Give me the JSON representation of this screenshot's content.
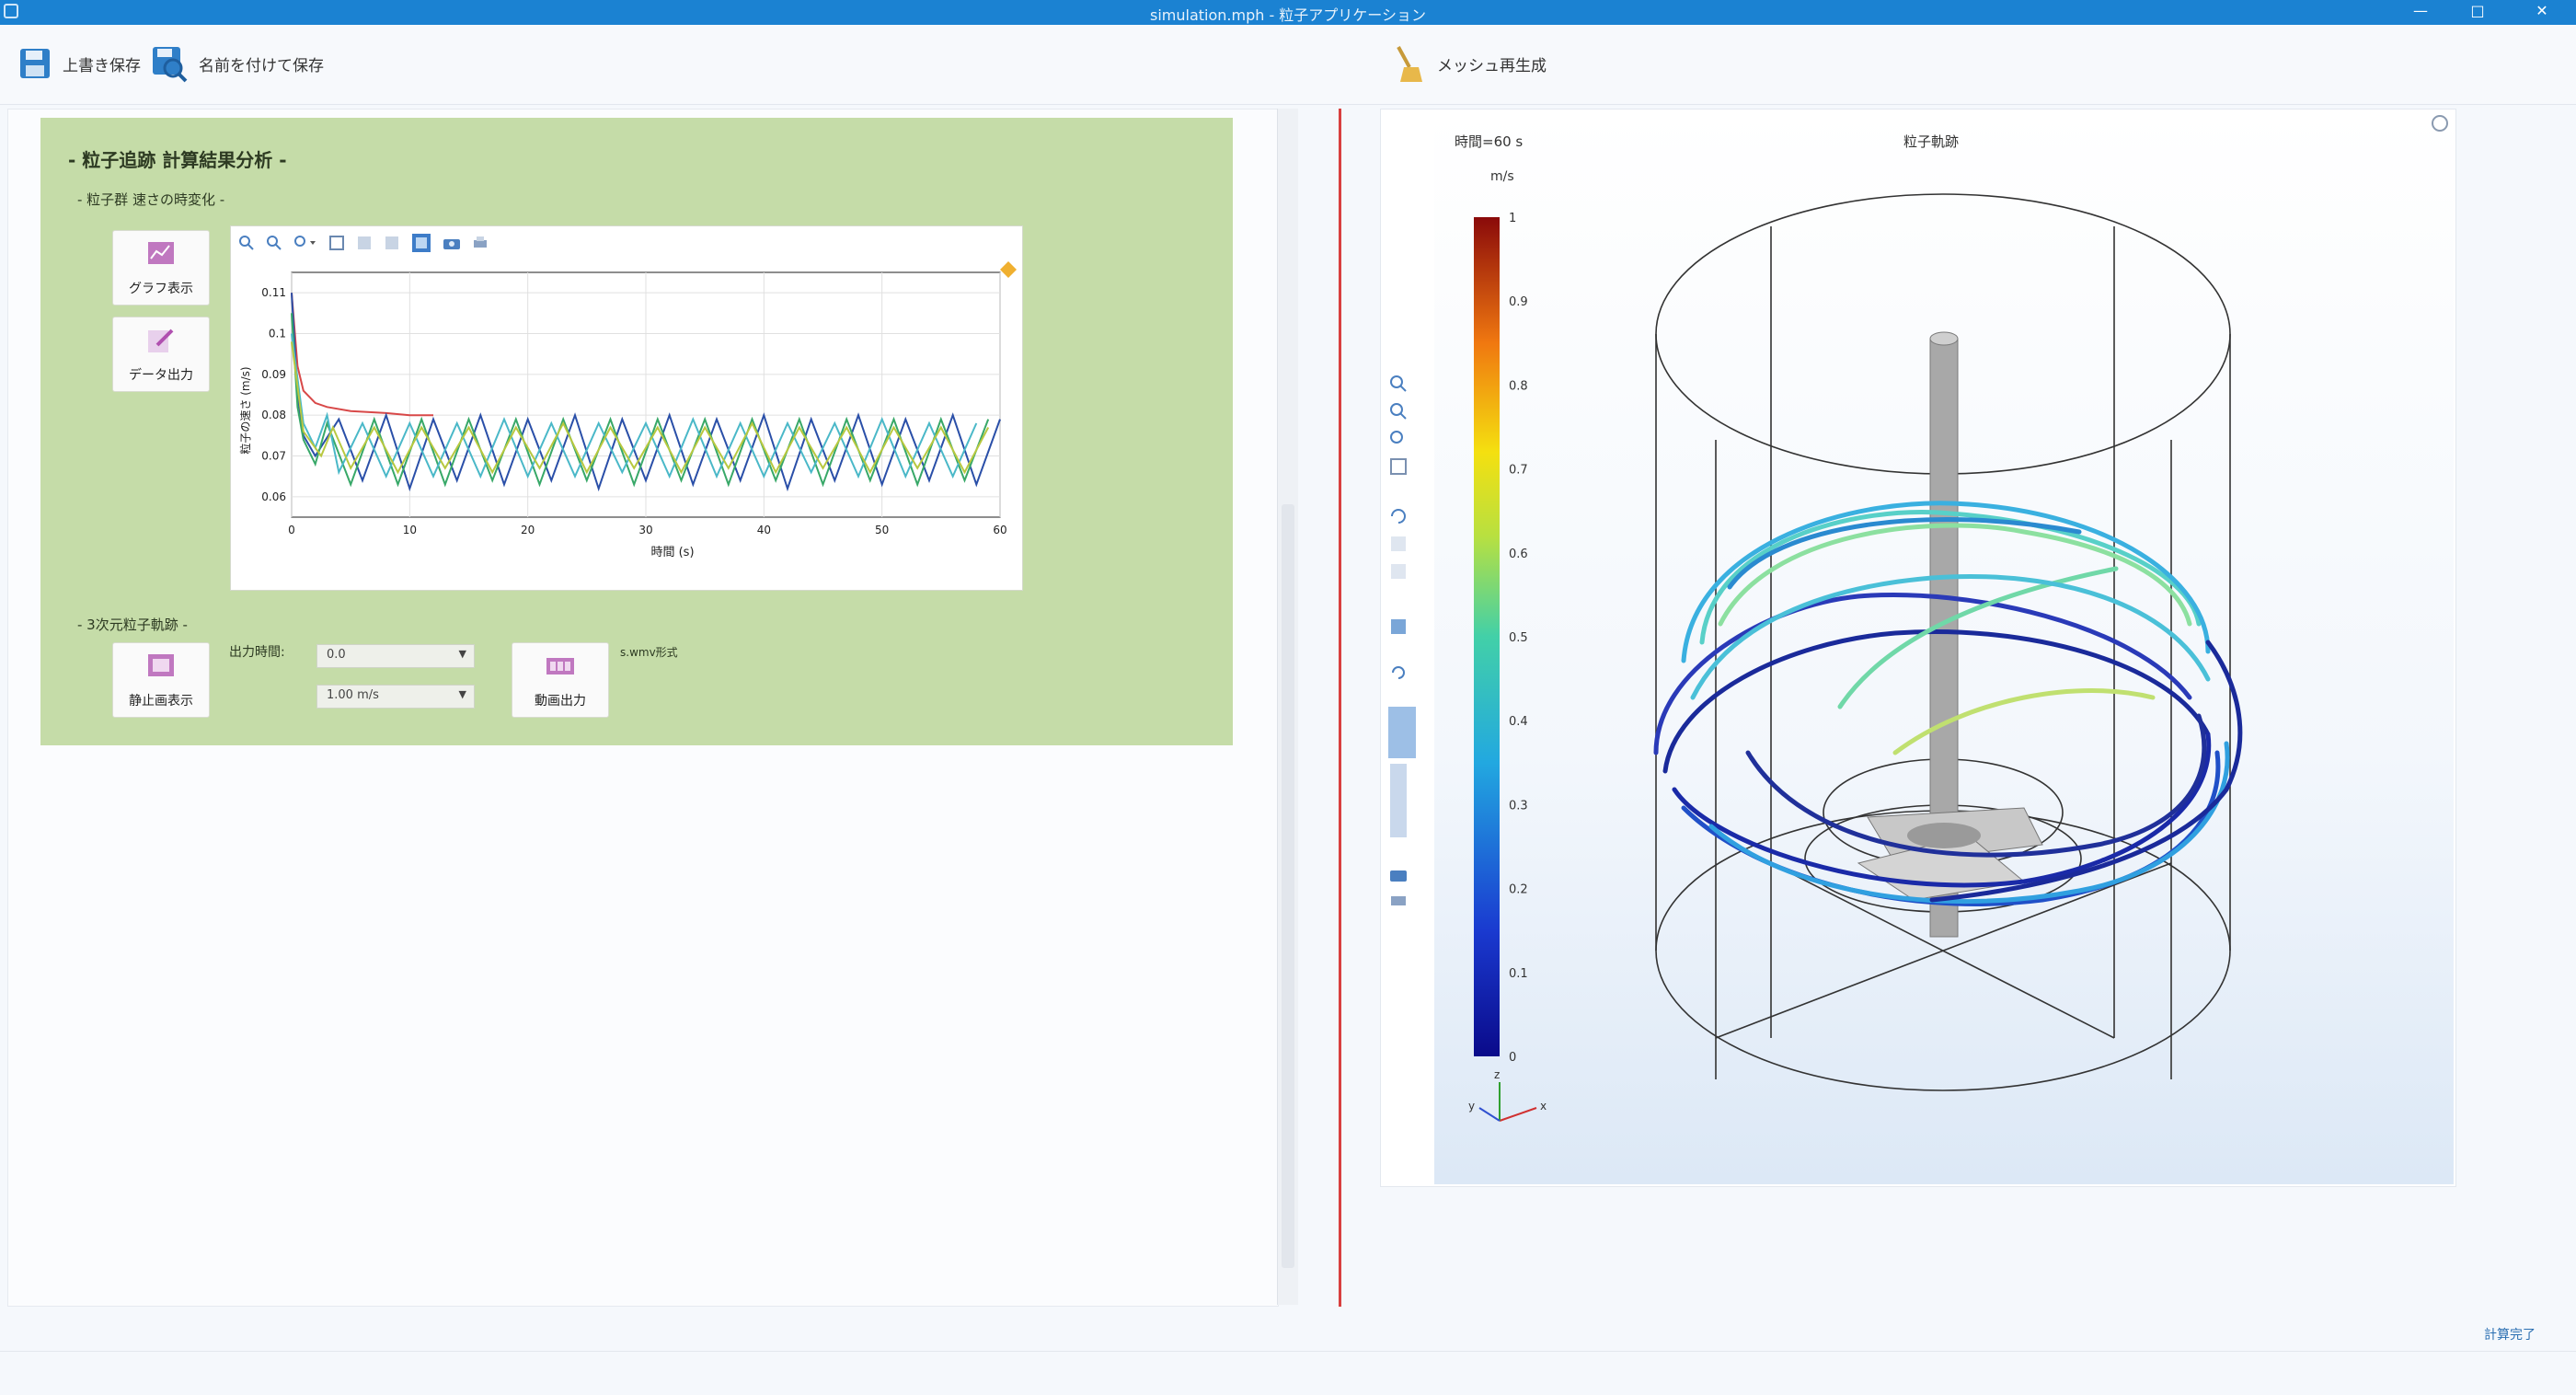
{
  "window": {
    "title": "simulation.mph - 粒子アプリケーション",
    "minimize": "—",
    "maximize": "□",
    "close": "✕"
  },
  "toolbar": {
    "save_label": "上書き保存",
    "save_as_label": "名前を付けて保存",
    "mesh_label": "メッシュ再生成"
  },
  "left": {
    "section_title": "- 粒子追跡 計算結果分析 -",
    "sub1": "- 粒子群 速さの時変化 -",
    "btn_graph": "グラフ表示",
    "btn_data": "データ出力",
    "sub2": "- 3次元粒子軌跡 -",
    "btn_stop": "静止画表示",
    "btn_anim": "動画出力",
    "time_label": "出力時間:",
    "time_value": "0.0",
    "speed_value": "1.00 m/s",
    "note": "s.wmv形式"
  },
  "chart_data": {
    "type": "line",
    "title": "",
    "xlabel": "時間 (s)",
    "ylabel": "粒子の速さ (m/s)",
    "xlim": [
      0,
      60
    ],
    "ylim": [
      0.055,
      0.115
    ],
    "x_ticks": [
      "0",
      "10",
      "20",
      "30",
      "40",
      "50",
      "60"
    ],
    "y_ticks": [
      "0.11",
      "0.1",
      "0.09",
      "0.08",
      "0.07",
      "0.06"
    ],
    "grid": true,
    "series": [
      {
        "color": "#d84848",
        "x": [
          0,
          0.5,
          1,
          2,
          3,
          5,
          8,
          10,
          12
        ],
        "y": [
          0.11,
          0.092,
          0.086,
          0.083,
          0.082,
          0.081,
          0.0805,
          0.08,
          0.08
        ]
      },
      {
        "color": "#2a4fa8",
        "x": [
          0,
          0.5,
          1,
          2,
          4,
          6,
          8,
          10,
          12,
          14,
          16,
          18,
          20,
          22,
          24,
          26,
          28,
          30,
          32,
          34,
          36,
          38,
          40,
          42,
          44,
          46,
          48,
          50,
          52,
          54,
          56,
          58,
          60
        ],
        "y": [
          0.11,
          0.085,
          0.075,
          0.07,
          0.079,
          0.064,
          0.08,
          0.062,
          0.079,
          0.064,
          0.08,
          0.063,
          0.079,
          0.064,
          0.08,
          0.062,
          0.079,
          0.064,
          0.08,
          0.063,
          0.079,
          0.064,
          0.08,
          0.062,
          0.079,
          0.064,
          0.08,
          0.063,
          0.079,
          0.064,
          0.08,
          0.063,
          0.079
        ]
      },
      {
        "color": "#38a868",
        "x": [
          0,
          0.5,
          1,
          2,
          3,
          5,
          7,
          9,
          11,
          13,
          15,
          17,
          19,
          21,
          23,
          25,
          27,
          29,
          31,
          33,
          35,
          37,
          39,
          41,
          43,
          45,
          47,
          49,
          51,
          53,
          55,
          57,
          59
        ],
        "y": [
          0.105,
          0.082,
          0.074,
          0.068,
          0.078,
          0.063,
          0.079,
          0.063,
          0.079,
          0.063,
          0.079,
          0.064,
          0.079,
          0.063,
          0.079,
          0.064,
          0.079,
          0.063,
          0.079,
          0.064,
          0.079,
          0.063,
          0.079,
          0.064,
          0.079,
          0.063,
          0.079,
          0.064,
          0.079,
          0.063,
          0.079,
          0.064,
          0.079
        ]
      },
      {
        "color": "#4ab8c8",
        "x": [
          0,
          1,
          2,
          3,
          4,
          6,
          8,
          10,
          12,
          14,
          16,
          18,
          20,
          22,
          24,
          26,
          28,
          30,
          32,
          34,
          36,
          38,
          40,
          42,
          44,
          46,
          48,
          50,
          52,
          54,
          56,
          58
        ],
        "y": [
          0.1,
          0.078,
          0.072,
          0.08,
          0.066,
          0.078,
          0.065,
          0.078,
          0.065,
          0.078,
          0.065,
          0.079,
          0.065,
          0.078,
          0.065,
          0.078,
          0.066,
          0.078,
          0.065,
          0.079,
          0.065,
          0.078,
          0.065,
          0.078,
          0.066,
          0.078,
          0.065,
          0.079,
          0.065,
          0.078,
          0.065,
          0.078
        ]
      },
      {
        "color": "#b8c840",
        "x": [
          0,
          1,
          2.5,
          3.5,
          5,
          7,
          9,
          11,
          13,
          15,
          17,
          19,
          21,
          23,
          25,
          27,
          29,
          31,
          33,
          35,
          37,
          39,
          41,
          43,
          45,
          47,
          49,
          51,
          53,
          55,
          57,
          59
        ],
        "y": [
          0.098,
          0.076,
          0.07,
          0.077,
          0.067,
          0.077,
          0.066,
          0.077,
          0.067,
          0.077,
          0.066,
          0.077,
          0.067,
          0.078,
          0.066,
          0.077,
          0.067,
          0.077,
          0.066,
          0.077,
          0.067,
          0.078,
          0.066,
          0.077,
          0.067,
          0.077,
          0.066,
          0.077,
          0.067,
          0.077,
          0.066,
          0.077
        ]
      }
    ]
  },
  "plot3d": {
    "time_label": "時間=60 s",
    "title": "粒子軌跡",
    "unit": "m/s",
    "colorbar_ticks": [
      "1",
      "0.9",
      "0.8",
      "0.7",
      "0.6",
      "0.5",
      "0.4",
      "0.3",
      "0.2",
      "0.1",
      "0"
    ],
    "axes": [
      "y",
      "z",
      "x"
    ]
  },
  "status": "計算完了"
}
